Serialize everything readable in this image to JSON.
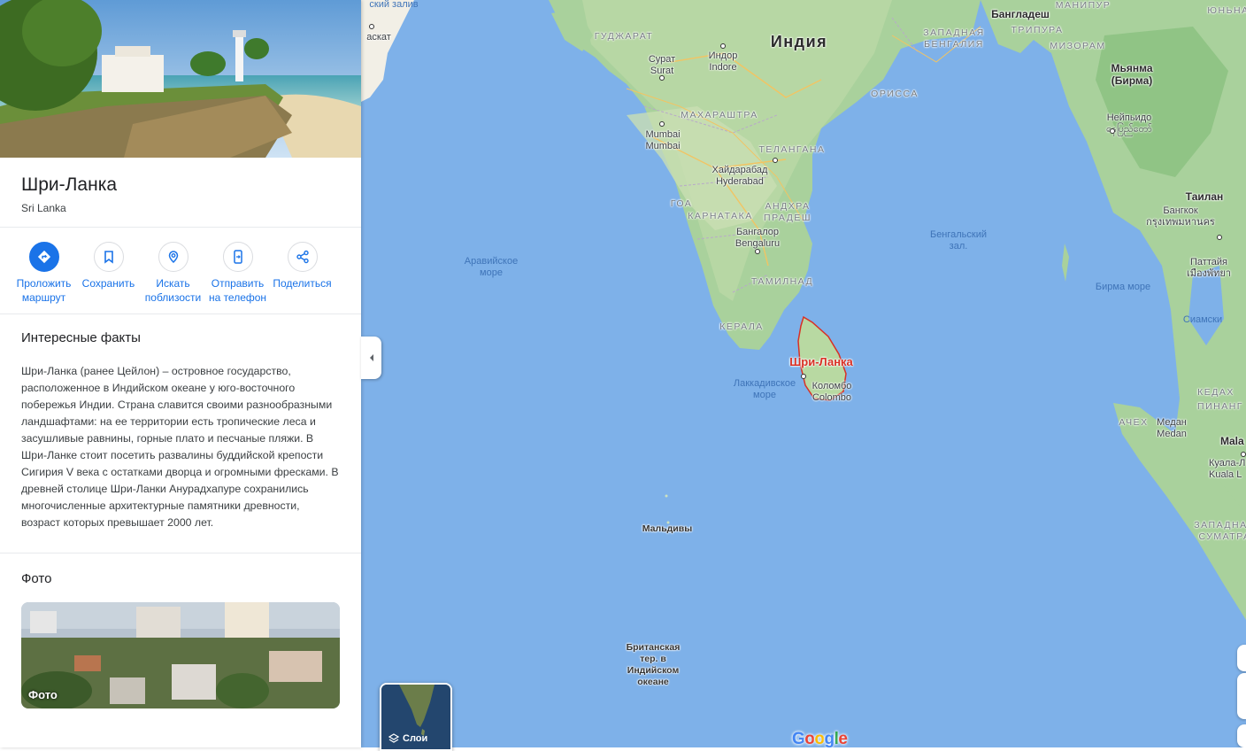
{
  "place": {
    "title": "Шри-Ланка",
    "subtitle": "Sri Lanka"
  },
  "actions": [
    {
      "label": "Проложить\nмаршрут",
      "icon": "directions-icon"
    },
    {
      "label": "Сохранить",
      "icon": "bookmark-icon"
    },
    {
      "label": "Искать\nпоблизости",
      "icon": "nearby-icon"
    },
    {
      "label": "Отправить\nна телефон",
      "icon": "send-to-phone-icon"
    },
    {
      "label": "Поделиться",
      "icon": "share-icon"
    }
  ],
  "facts": {
    "title": "Интересные факты",
    "text": "Шри-Ланка (ранее Цейлон) – островное государство, расположенное в Индийском океане у юго-восточного побережья Индии. Страна славится своими разнообразными ландшафтами: на ее территории есть тропические леса и засушливые равнины, горные плато и песчаные пляжи. В Шри-Ланке стоит посетить развалины буддийской крепости Сигирия V века с остатками дворца и огромными фресками. В древней столице Шри-Ланки Анурадхапуре сохранились многочисленные архитектурные памятники древности, возраст которых превышает 2000 лет."
  },
  "photos": {
    "title": "Фото",
    "card_label": "Фото"
  },
  "map": {
    "layers_label": "Слои",
    "google_logo": "Google",
    "labels": {
      "gulf": "ский залив",
      "karachi": "аскат",
      "gujarat": "ГУДЖАРАТ",
      "india": "Индия",
      "bangladesh": "Бангладеш",
      "manipur": "МАНИПУР",
      "west_bengal": "ЗАПАДНАЯ\nБЕНГАЛИЯ",
      "tripura": "ТРИПУРА",
      "mizoram": "МИЗОРАМ",
      "surat": "Сурат\nSurat",
      "indore": "Индор\nIndore",
      "orissa": "ОРИССА",
      "myanmar": "Мьянма\n(Бирма)",
      "naypyidaw": "Нейпьидо\nနေပြည်တော်",
      "maharashtra": "МАХАРАШТРА",
      "mumbai": "Mumbai\nMumbai",
      "telangana": "ТЕЛАНГАНА",
      "hyderabad": "Хайдарабад\nHyderabad",
      "goa": "ГОА",
      "karnataka": "КАРНАТАКА",
      "andhra": "АНДХРА\nПРАДЕШ",
      "bangalore": "Бангалор\nBengaluru",
      "tamilnadu": "ТАМИЛНАД",
      "kerala": "КЕРАЛА",
      "arabian_sea": "Аравийское\nморе",
      "bay_bengal": "Бенгальский\nзал.",
      "burma_sea": "Бирма море",
      "thailand": "Таилан",
      "bangkok": "Бангкок\nกรุงเทพมหานคร",
      "pattaya": "Паттайя\nเมืองพัทยา",
      "siam_gulf": "Сиамски",
      "srilanka": "Шри-Ланка",
      "colombo": "Коломбо\nColombo",
      "laccadive": "Лаккадивское\nморе",
      "maldives": "Мальдивы",
      "biot": "Британская\nтер. в\nИндийском\nокеане",
      "kedah": "КЕДАХ",
      "pinang": "ПИНАНГ",
      "aceh": "АЧЕХ",
      "medan": "Медан\nMedan",
      "malaysia": "Mala",
      "kuala": "Куала-Л\nKuala L",
      "west_sumatra": "ЗАПАДНАЯ\nСУМАТРА",
      "yunnan": "ЮНЬНА"
    }
  }
}
